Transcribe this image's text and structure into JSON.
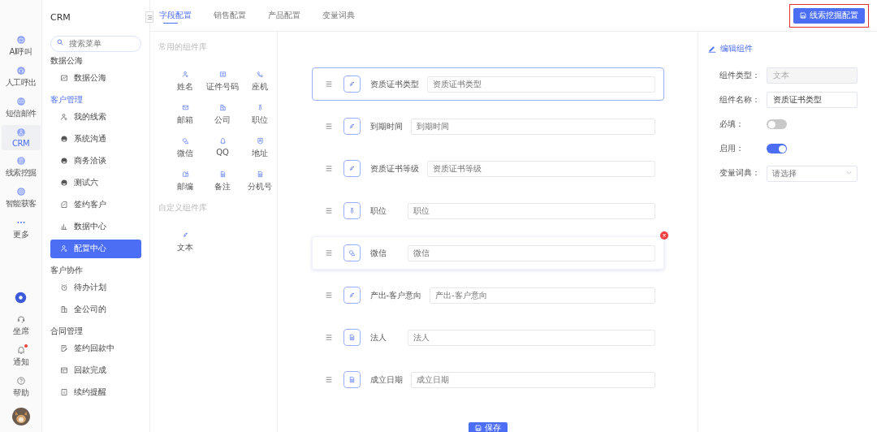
{
  "rail": {
    "items": [
      {
        "label": "AI呼叫",
        "selected": false
      },
      {
        "label": "人工呼出",
        "selected": false
      },
      {
        "label": "短信邮件",
        "selected": false
      },
      {
        "label": "CRM",
        "selected": true
      },
      {
        "label": "线索挖掘",
        "selected": false
      },
      {
        "label": "智能获客",
        "selected": false
      },
      {
        "label": "更多",
        "selected": false
      }
    ],
    "bottom": [
      {
        "label": "坐席",
        "badge": false
      },
      {
        "label": "通知",
        "badge": true
      },
      {
        "label": "帮助",
        "badge": false
      }
    ]
  },
  "menu": {
    "title": "CRM",
    "search_placeholder": "搜索菜单",
    "groups": [
      {
        "label": "数据公海",
        "active": false,
        "items": [
          {
            "label": "数据公海",
            "selected": false
          }
        ]
      },
      {
        "label": "客户管理",
        "active": true,
        "items": [
          {
            "label": "我的线索",
            "selected": false
          },
          {
            "label": "系统沟通",
            "selected": false
          },
          {
            "label": "商务洽谈",
            "selected": false
          },
          {
            "label": "测试六",
            "selected": false
          },
          {
            "label": "签约客户",
            "selected": false
          },
          {
            "label": "数据中心",
            "selected": false
          },
          {
            "label": "配置中心",
            "selected": true
          }
        ]
      },
      {
        "label": "客户协作",
        "active": false,
        "items": [
          {
            "label": "待办计划",
            "selected": false
          },
          {
            "label": "全公司的",
            "selected": false
          }
        ]
      },
      {
        "label": "合同管理",
        "active": false,
        "items": [
          {
            "label": "签约回款中",
            "selected": false
          },
          {
            "label": "回款完成",
            "selected": false
          },
          {
            "label": "续约提醒",
            "selected": false
          }
        ]
      }
    ]
  },
  "tabs": [
    {
      "label": "字段配置",
      "selected": true
    },
    {
      "label": "销售配置",
      "selected": false
    },
    {
      "label": "产品配置",
      "selected": false
    },
    {
      "label": "变量词典",
      "selected": false
    }
  ],
  "top_button": {
    "label": "线索挖掘配置",
    "highlighted": true
  },
  "library": {
    "common_title": "常用的组件库",
    "common": [
      {
        "label": "姓名"
      },
      {
        "label": "证件号码"
      },
      {
        "label": "座机"
      },
      {
        "label": "邮箱"
      },
      {
        "label": "公司"
      },
      {
        "label": "职位"
      },
      {
        "label": "微信"
      },
      {
        "label": "QQ"
      },
      {
        "label": "地址"
      },
      {
        "label": "邮编"
      },
      {
        "label": "备注"
      },
      {
        "label": "分机号"
      }
    ],
    "custom_title": "自定义组件库",
    "custom": [
      {
        "label": "文本"
      }
    ]
  },
  "fields": [
    {
      "label": "资质证书类型",
      "placeholder": "资质证书类型",
      "kind": "text",
      "selected": true,
      "hovered": false
    },
    {
      "label": "到期时间",
      "placeholder": "到期时间",
      "kind": "text",
      "selected": false,
      "hovered": false
    },
    {
      "label": "资质证书等级",
      "placeholder": "资质证书等级",
      "kind": "text",
      "selected": false,
      "hovered": false
    },
    {
      "label": "职位",
      "placeholder": "职位",
      "kind": "job",
      "selected": false,
      "hovered": false
    },
    {
      "label": "微信",
      "placeholder": "微信",
      "kind": "wechat",
      "selected": false,
      "hovered": true
    },
    {
      "label": "产出-客户意向",
      "placeholder": "产出-客户意向",
      "kind": "text",
      "selected": false,
      "hovered": false
    },
    {
      "label": "法人",
      "placeholder": "法人",
      "kind": "document",
      "selected": false,
      "hovered": false
    },
    {
      "label": "成立日期",
      "placeholder": "成立日期",
      "kind": "document",
      "selected": false,
      "hovered": false
    }
  ],
  "save_button": "保存",
  "editor": {
    "title": "编辑组件",
    "rows": [
      {
        "kind": "input",
        "label": "组件类型：",
        "value": "文本",
        "disabled": true
      },
      {
        "kind": "input",
        "label": "组件名称：",
        "value": "资质证书类型",
        "disabled": false
      },
      {
        "kind": "switch",
        "label": "必填：",
        "on": false
      },
      {
        "kind": "switch",
        "label": "启用：",
        "on": true
      },
      {
        "kind": "select",
        "label": "变量词典：",
        "placeholder": "请选择"
      }
    ]
  }
}
